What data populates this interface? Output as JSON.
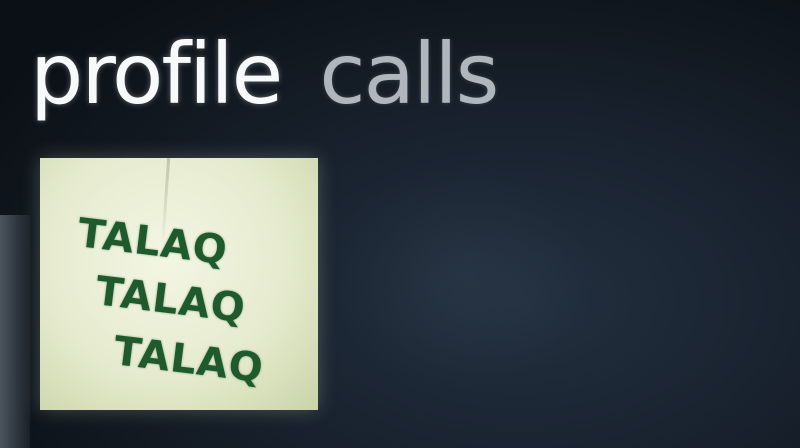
{
  "pivot": {
    "tabs": [
      {
        "label": "profile",
        "active": true
      },
      {
        "label": "calls",
        "active": false
      }
    ]
  },
  "profile_picture": {
    "lines": [
      "TALAQ",
      "TALAQ",
      "TALAQ"
    ],
    "ink_color": "#1f5a2c",
    "paper_color": "#eef2da"
  },
  "colors": {
    "background": "#0c1118",
    "active_tab": "#f7f9fb",
    "inactive_tab": "#c5ccd3"
  }
}
